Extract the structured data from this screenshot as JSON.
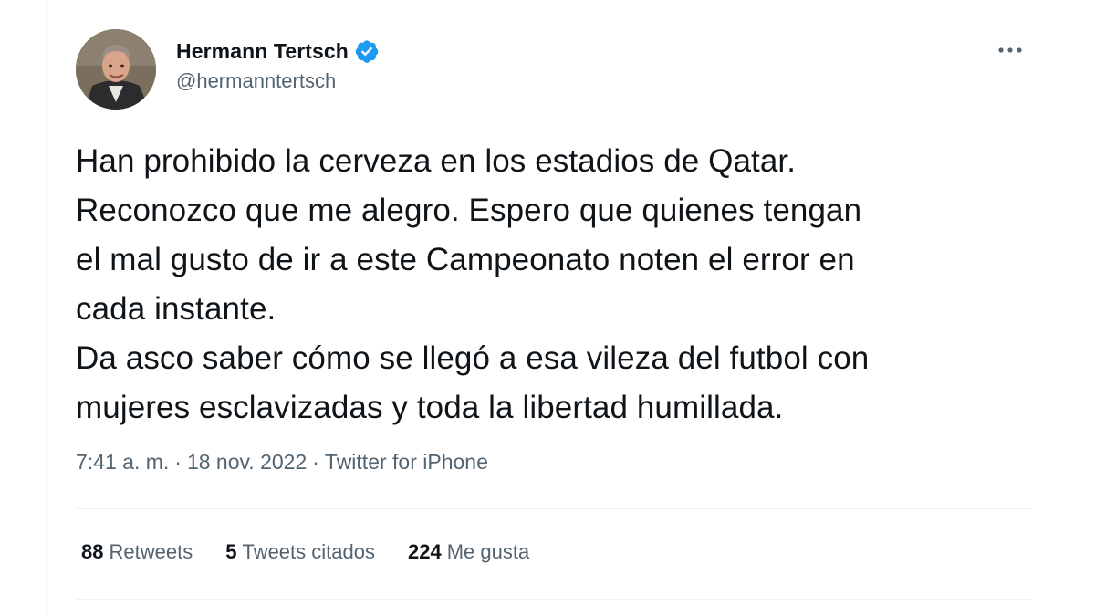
{
  "author": {
    "display_name": "Hermann Tertsch",
    "handle": "@hermanntertsch",
    "verified": true
  },
  "menu": {
    "more_icon": "more-horizontal-icon"
  },
  "tweet": {
    "text": "Han prohibido la cerveza en los estadios de Qatar.\nReconozco que me alegro. Espero que quienes tengan\nel mal gusto de ir a este Campeonato noten el error en\ncada instante.\nDa asco saber cómo se llegó a esa vileza del futbol con\nmujeres esclavizadas y toda la libertad humillada.",
    "time": "7:41 a. m.",
    "separator": "·",
    "date": "18 nov. 2022",
    "source": "Twitter for iPhone"
  },
  "stats": {
    "retweets_count": "88",
    "retweets_label": "Retweets",
    "quotes_count": "5",
    "quotes_label": "Tweets citados",
    "likes_count": "224",
    "likes_label": "Me gusta"
  },
  "colors": {
    "text": "#0f1419",
    "secondary": "#536471",
    "verified_blue": "#1d9bf0",
    "divider": "#eff3f4"
  }
}
